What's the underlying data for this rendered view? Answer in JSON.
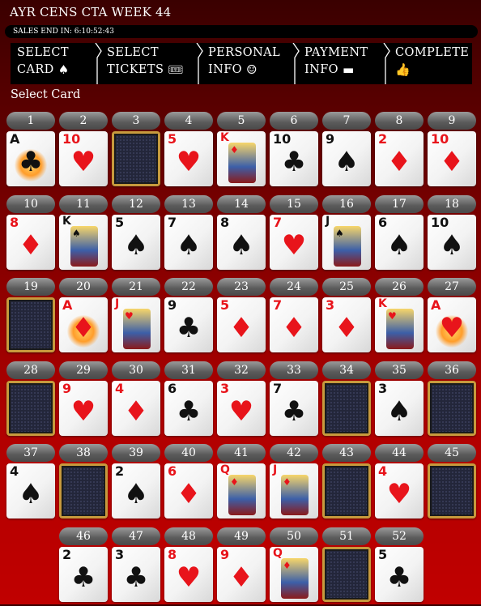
{
  "header": {
    "title": "AYR CENS CTA WEEK 44",
    "sales_end": "SALES END IN: 6:10:52:43"
  },
  "steps": [
    {
      "l1": "SELECT",
      "l2": "CARD",
      "icon": "♠",
      "icon_name": "spade-icon"
    },
    {
      "l1": "SELECT",
      "l2": "TICKETS",
      "icon": "🎟",
      "icon_name": "ticket-icon"
    },
    {
      "l1": "PERSONAL",
      "l2": "INFO",
      "icon": "☺",
      "icon_name": "user-circle-icon"
    },
    {
      "l1": "PAYMENT",
      "l2": "INFO",
      "icon": "▬",
      "icon_name": "credit-card-icon"
    },
    {
      "l1": "COMPLETE",
      "l2": "",
      "icon": "👍",
      "icon_name": "thumbs-up-icon"
    }
  ],
  "section_label": "Select Card",
  "cards": [
    {
      "n": "1",
      "rank": "A",
      "suit": "clubs",
      "face": false,
      "taken": false
    },
    {
      "n": "2",
      "rank": "10",
      "suit": "hearts",
      "face": false,
      "taken": false
    },
    {
      "n": "3",
      "rank": "",
      "suit": "",
      "face": false,
      "taken": true
    },
    {
      "n": "4",
      "rank": "5",
      "suit": "hearts",
      "face": false,
      "taken": false
    },
    {
      "n": "5",
      "rank": "K",
      "suit": "diamonds",
      "face": true,
      "taken": false
    },
    {
      "n": "6",
      "rank": "10",
      "suit": "clubs",
      "face": false,
      "taken": false
    },
    {
      "n": "7",
      "rank": "9",
      "suit": "spades",
      "face": false,
      "taken": false
    },
    {
      "n": "8",
      "rank": "2",
      "suit": "diamonds",
      "face": false,
      "taken": false
    },
    {
      "n": "9",
      "rank": "10",
      "suit": "diamonds",
      "face": false,
      "taken": false
    },
    {
      "n": "10",
      "rank": "8",
      "suit": "diamonds",
      "face": false,
      "taken": false
    },
    {
      "n": "11",
      "rank": "K",
      "suit": "spades",
      "face": true,
      "taken": false
    },
    {
      "n": "12",
      "rank": "5",
      "suit": "spades",
      "face": false,
      "taken": false
    },
    {
      "n": "13",
      "rank": "7",
      "suit": "spades",
      "face": false,
      "taken": false
    },
    {
      "n": "14",
      "rank": "8",
      "suit": "spades",
      "face": false,
      "taken": false
    },
    {
      "n": "15",
      "rank": "7",
      "suit": "hearts",
      "face": false,
      "taken": false
    },
    {
      "n": "16",
      "rank": "J",
      "suit": "spades",
      "face": true,
      "taken": false
    },
    {
      "n": "17",
      "rank": "6",
      "suit": "spades",
      "face": false,
      "taken": false
    },
    {
      "n": "18",
      "rank": "10",
      "suit": "spades",
      "face": false,
      "taken": false
    },
    {
      "n": "19",
      "rank": "",
      "suit": "",
      "face": false,
      "taken": true
    },
    {
      "n": "20",
      "rank": "A",
      "suit": "diamonds",
      "face": false,
      "taken": false
    },
    {
      "n": "21",
      "rank": "J",
      "suit": "hearts",
      "face": true,
      "taken": false
    },
    {
      "n": "22",
      "rank": "9",
      "suit": "clubs",
      "face": false,
      "taken": false
    },
    {
      "n": "23",
      "rank": "5",
      "suit": "diamonds",
      "face": false,
      "taken": false
    },
    {
      "n": "24",
      "rank": "7",
      "suit": "diamonds",
      "face": false,
      "taken": false
    },
    {
      "n": "25",
      "rank": "3",
      "suit": "diamonds",
      "face": false,
      "taken": false
    },
    {
      "n": "26",
      "rank": "K",
      "suit": "hearts",
      "face": true,
      "taken": false
    },
    {
      "n": "27",
      "rank": "A",
      "suit": "hearts",
      "face": false,
      "taken": false
    },
    {
      "n": "28",
      "rank": "",
      "suit": "",
      "face": false,
      "taken": true
    },
    {
      "n": "29",
      "rank": "9",
      "suit": "hearts",
      "face": false,
      "taken": false
    },
    {
      "n": "30",
      "rank": "4",
      "suit": "diamonds",
      "face": false,
      "taken": false
    },
    {
      "n": "31",
      "rank": "6",
      "suit": "clubs",
      "face": false,
      "taken": false
    },
    {
      "n": "32",
      "rank": "3",
      "suit": "hearts",
      "face": false,
      "taken": false
    },
    {
      "n": "33",
      "rank": "7",
      "suit": "clubs",
      "face": false,
      "taken": false
    },
    {
      "n": "34",
      "rank": "",
      "suit": "",
      "face": false,
      "taken": true
    },
    {
      "n": "35",
      "rank": "3",
      "suit": "spades",
      "face": false,
      "taken": false
    },
    {
      "n": "36",
      "rank": "",
      "suit": "",
      "face": false,
      "taken": true
    },
    {
      "n": "37",
      "rank": "4",
      "suit": "spades",
      "face": false,
      "taken": false
    },
    {
      "n": "38",
      "rank": "",
      "suit": "",
      "face": false,
      "taken": true
    },
    {
      "n": "39",
      "rank": "2",
      "suit": "spades",
      "face": false,
      "taken": false
    },
    {
      "n": "40",
      "rank": "6",
      "suit": "diamonds",
      "face": false,
      "taken": false
    },
    {
      "n": "41",
      "rank": "Q",
      "suit": "diamonds",
      "face": true,
      "taken": false
    },
    {
      "n": "42",
      "rank": "J",
      "suit": "diamonds",
      "face": true,
      "taken": false
    },
    {
      "n": "43",
      "rank": "",
      "suit": "",
      "face": false,
      "taken": true
    },
    {
      "n": "44",
      "rank": "4",
      "suit": "hearts",
      "face": false,
      "taken": false
    },
    {
      "n": "45",
      "rank": "",
      "suit": "",
      "face": false,
      "taken": true
    },
    {
      "n": "46",
      "rank": "2",
      "suit": "clubs",
      "face": false,
      "taken": false
    },
    {
      "n": "47",
      "rank": "3",
      "suit": "clubs",
      "face": false,
      "taken": false
    },
    {
      "n": "48",
      "rank": "8",
      "suit": "hearts",
      "face": false,
      "taken": false
    },
    {
      "n": "49",
      "rank": "9",
      "suit": "diamonds",
      "face": false,
      "taken": false
    },
    {
      "n": "50",
      "rank": "Q",
      "suit": "diamonds",
      "face": true,
      "taken": false
    },
    {
      "n": "51",
      "rank": "",
      "suit": "",
      "face": false,
      "taken": true
    },
    {
      "n": "52",
      "rank": "5",
      "suit": "clubs",
      "face": false,
      "taken": false
    }
  ],
  "colors": {
    "red_suit": "#e8141b",
    "black_suit": "#111111",
    "background": "#a00000",
    "card_back_border": "#c79a3d"
  }
}
